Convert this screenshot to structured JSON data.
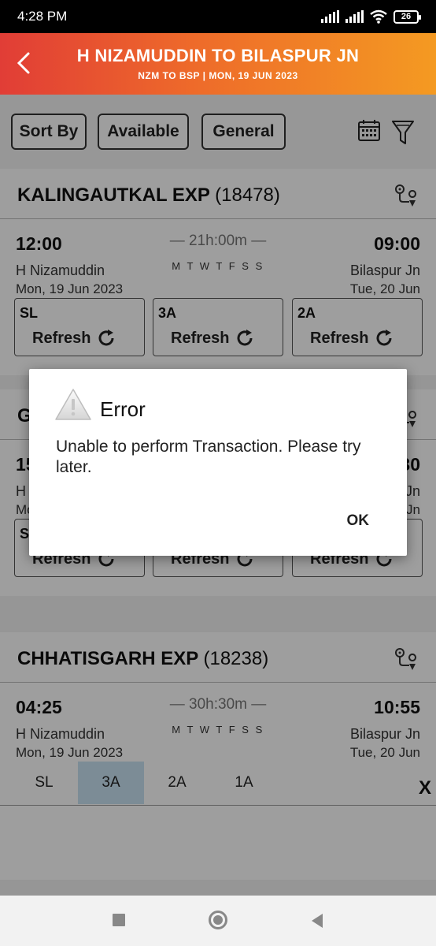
{
  "status_bar": {
    "time": "4:28 PM",
    "battery": "26"
  },
  "header": {
    "title": "H NIZAMUDDIN TO BILASPUR JN",
    "subtitle": "NZM TO BSP | MON, 19 JUN  2023"
  },
  "filters": {
    "sort_by": "Sort By",
    "available": "Available",
    "general": "General"
  },
  "trains": [
    {
      "name": "KALINGAUTKAL EXP",
      "number": "(18478)",
      "dep_time": "12:00",
      "dep_station": "H Nizamuddin",
      "dep_date": "Mon, 19 Jun  2023",
      "arr_time": "09:00",
      "arr_station": "Bilaspur Jn",
      "arr_date": "Tue, 20 Jun",
      "duration": "— 21h:00m —",
      "days": "M T W T F S S",
      "classes": [
        {
          "name": "SL",
          "action": "Refresh"
        },
        {
          "name": "3A",
          "action": "Refresh"
        },
        {
          "name": "2A",
          "action": "Refresh"
        }
      ]
    },
    {
      "name": "G",
      "number": "",
      "dep_time": "15",
      "dep_station": "H",
      "dep_date": "Mo",
      "arr_time": "30",
      "arr_station": "Jn",
      "arr_date": "Jn",
      "classes": [
        {
          "name": "S",
          "action": "Refresh"
        },
        {
          "name": "",
          "action": "Refresh"
        },
        {
          "name": "",
          "action": "Refresh"
        }
      ]
    },
    {
      "name": "CHHATISGARH EXP",
      "number": "(18238)",
      "dep_time": "04:25",
      "dep_station": "H Nizamuddin",
      "dep_date": "Mon, 19 Jun  2023",
      "arr_time": "10:55",
      "arr_station": "Bilaspur Jn",
      "arr_date": "Tue, 20 Jun",
      "duration": "— 30h:30m —",
      "days": "M T W T F S S",
      "tabs": [
        "SL",
        "3A",
        "2A",
        "1A"
      ],
      "active_tab": "3A",
      "close": "X"
    }
  ],
  "dialog": {
    "title": "Error",
    "message": "Unable to perform Transaction. Please try later.",
    "ok": "OK"
  }
}
